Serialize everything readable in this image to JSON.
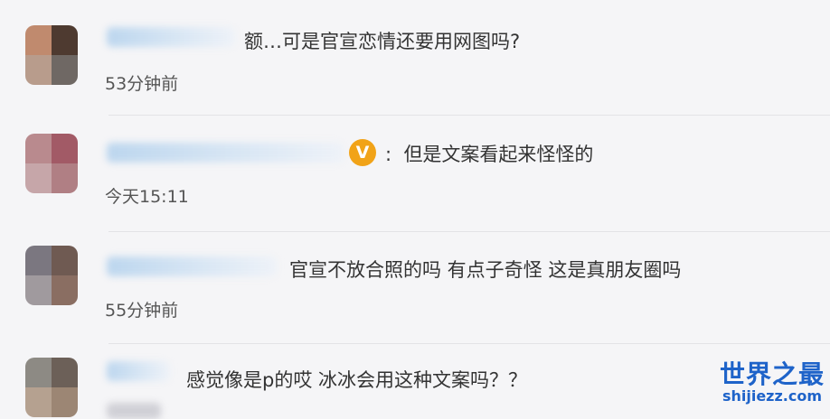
{
  "comments": [
    {
      "text": "额…可是官宣恋情还要用网图吗?",
      "time": "53分钟前",
      "verified": false
    },
    {
      "text": "但是文案看起来怪怪的",
      "time": "今天15:11",
      "verified": true,
      "badge": "V"
    },
    {
      "text": "官宣不放合照的吗 有点子奇怪 这是真朋友圈吗",
      "time": "55分钟前",
      "verified": false
    },
    {
      "text": "感觉像是p的哎 冰冰会用这种文案吗？？",
      "time": "",
      "verified": false
    }
  ],
  "watermark": {
    "title": "世界之最",
    "url": "shijiezz.com"
  },
  "colors": {
    "verified_badge": "#f1a318",
    "watermark": "#1e63c9"
  }
}
